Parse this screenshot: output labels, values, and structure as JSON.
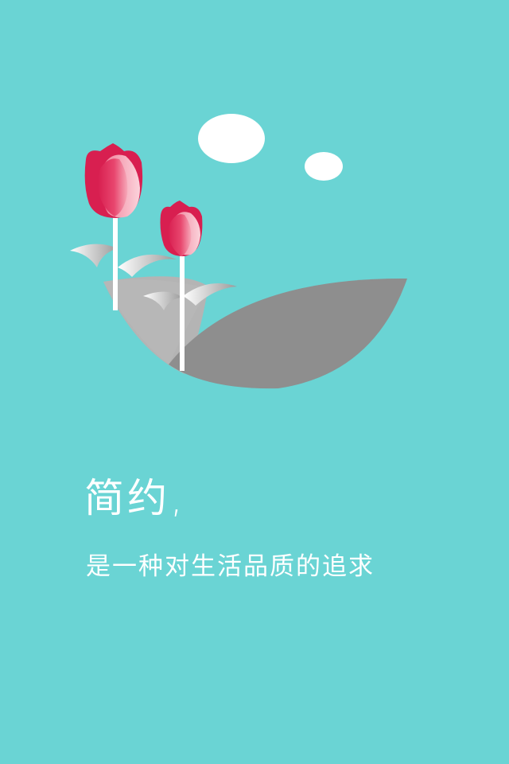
{
  "splash": {
    "background_color": "#6ad4d4",
    "illustration": {
      "elements": [
        "cloud",
        "cloud",
        "tulip",
        "tulip",
        "hill",
        "hill"
      ],
      "tulip_color": "#e8466e",
      "hill_color_light": "#b3b3b3",
      "hill_color_dark": "#8e8e8e"
    },
    "headline": "简约,",
    "subline": "是一种对生活品质的追求"
  }
}
